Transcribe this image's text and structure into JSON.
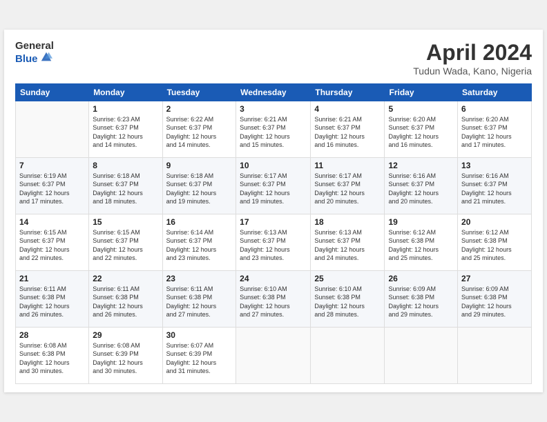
{
  "header": {
    "logo_general": "General",
    "logo_blue": "Blue",
    "month_title": "April 2024",
    "subtitle": "Tudun Wada, Kano, Nigeria"
  },
  "columns": [
    "Sunday",
    "Monday",
    "Tuesday",
    "Wednesday",
    "Thursday",
    "Friday",
    "Saturday"
  ],
  "weeks": [
    {
      "stripe": false,
      "days": [
        {
          "num": "",
          "info": ""
        },
        {
          "num": "1",
          "info": "Sunrise: 6:23 AM\nSunset: 6:37 PM\nDaylight: 12 hours\nand 14 minutes."
        },
        {
          "num": "2",
          "info": "Sunrise: 6:22 AM\nSunset: 6:37 PM\nDaylight: 12 hours\nand 14 minutes."
        },
        {
          "num": "3",
          "info": "Sunrise: 6:21 AM\nSunset: 6:37 PM\nDaylight: 12 hours\nand 15 minutes."
        },
        {
          "num": "4",
          "info": "Sunrise: 6:21 AM\nSunset: 6:37 PM\nDaylight: 12 hours\nand 16 minutes."
        },
        {
          "num": "5",
          "info": "Sunrise: 6:20 AM\nSunset: 6:37 PM\nDaylight: 12 hours\nand 16 minutes."
        },
        {
          "num": "6",
          "info": "Sunrise: 6:20 AM\nSunset: 6:37 PM\nDaylight: 12 hours\nand 17 minutes."
        }
      ]
    },
    {
      "stripe": true,
      "days": [
        {
          "num": "7",
          "info": "Sunrise: 6:19 AM\nSunset: 6:37 PM\nDaylight: 12 hours\nand 17 minutes."
        },
        {
          "num": "8",
          "info": "Sunrise: 6:18 AM\nSunset: 6:37 PM\nDaylight: 12 hours\nand 18 minutes."
        },
        {
          "num": "9",
          "info": "Sunrise: 6:18 AM\nSunset: 6:37 PM\nDaylight: 12 hours\nand 19 minutes."
        },
        {
          "num": "10",
          "info": "Sunrise: 6:17 AM\nSunset: 6:37 PM\nDaylight: 12 hours\nand 19 minutes."
        },
        {
          "num": "11",
          "info": "Sunrise: 6:17 AM\nSunset: 6:37 PM\nDaylight: 12 hours\nand 20 minutes."
        },
        {
          "num": "12",
          "info": "Sunrise: 6:16 AM\nSunset: 6:37 PM\nDaylight: 12 hours\nand 20 minutes."
        },
        {
          "num": "13",
          "info": "Sunrise: 6:16 AM\nSunset: 6:37 PM\nDaylight: 12 hours\nand 21 minutes."
        }
      ]
    },
    {
      "stripe": false,
      "days": [
        {
          "num": "14",
          "info": "Sunrise: 6:15 AM\nSunset: 6:37 PM\nDaylight: 12 hours\nand 22 minutes."
        },
        {
          "num": "15",
          "info": "Sunrise: 6:15 AM\nSunset: 6:37 PM\nDaylight: 12 hours\nand 22 minutes."
        },
        {
          "num": "16",
          "info": "Sunrise: 6:14 AM\nSunset: 6:37 PM\nDaylight: 12 hours\nand 23 minutes."
        },
        {
          "num": "17",
          "info": "Sunrise: 6:13 AM\nSunset: 6:37 PM\nDaylight: 12 hours\nand 23 minutes."
        },
        {
          "num": "18",
          "info": "Sunrise: 6:13 AM\nSunset: 6:37 PM\nDaylight: 12 hours\nand 24 minutes."
        },
        {
          "num": "19",
          "info": "Sunrise: 6:12 AM\nSunset: 6:38 PM\nDaylight: 12 hours\nand 25 minutes."
        },
        {
          "num": "20",
          "info": "Sunrise: 6:12 AM\nSunset: 6:38 PM\nDaylight: 12 hours\nand 25 minutes."
        }
      ]
    },
    {
      "stripe": true,
      "days": [
        {
          "num": "21",
          "info": "Sunrise: 6:11 AM\nSunset: 6:38 PM\nDaylight: 12 hours\nand 26 minutes."
        },
        {
          "num": "22",
          "info": "Sunrise: 6:11 AM\nSunset: 6:38 PM\nDaylight: 12 hours\nand 26 minutes."
        },
        {
          "num": "23",
          "info": "Sunrise: 6:11 AM\nSunset: 6:38 PM\nDaylight: 12 hours\nand 27 minutes."
        },
        {
          "num": "24",
          "info": "Sunrise: 6:10 AM\nSunset: 6:38 PM\nDaylight: 12 hours\nand 27 minutes."
        },
        {
          "num": "25",
          "info": "Sunrise: 6:10 AM\nSunset: 6:38 PM\nDaylight: 12 hours\nand 28 minutes."
        },
        {
          "num": "26",
          "info": "Sunrise: 6:09 AM\nSunset: 6:38 PM\nDaylight: 12 hours\nand 29 minutes."
        },
        {
          "num": "27",
          "info": "Sunrise: 6:09 AM\nSunset: 6:38 PM\nDaylight: 12 hours\nand 29 minutes."
        }
      ]
    },
    {
      "stripe": false,
      "days": [
        {
          "num": "28",
          "info": "Sunrise: 6:08 AM\nSunset: 6:38 PM\nDaylight: 12 hours\nand 30 minutes."
        },
        {
          "num": "29",
          "info": "Sunrise: 6:08 AM\nSunset: 6:39 PM\nDaylight: 12 hours\nand 30 minutes."
        },
        {
          "num": "30",
          "info": "Sunrise: 6:07 AM\nSunset: 6:39 PM\nDaylight: 12 hours\nand 31 minutes."
        },
        {
          "num": "",
          "info": ""
        },
        {
          "num": "",
          "info": ""
        },
        {
          "num": "",
          "info": ""
        },
        {
          "num": "",
          "info": ""
        }
      ]
    }
  ]
}
